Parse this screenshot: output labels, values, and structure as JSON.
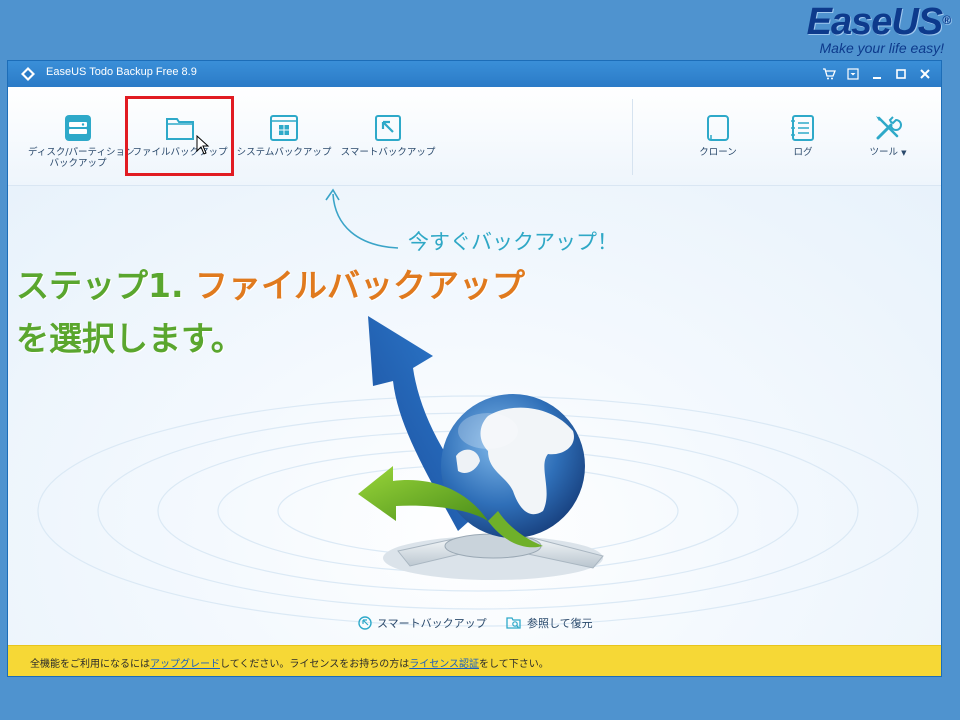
{
  "brand": {
    "name": "EaseUS",
    "reg": "®",
    "slogan": "Make your life easy!"
  },
  "window": {
    "title": "EaseUS Todo Backup Free 8.9"
  },
  "toolbar": {
    "disk_backup_line1": "ディスク/パーティション",
    "disk_backup_line2": "バックアップ",
    "file_backup": "ファイルバックアップ",
    "system_backup": "システムバックアップ",
    "smart_backup": "スマートバックアップ",
    "clone": "クローン",
    "log": "ログ",
    "tools": "ツール"
  },
  "content": {
    "cta": "今すぐバックアップ！",
    "step_prefix": "ステップ1.",
    "step_highlight": "ファイルバックアップ",
    "step_suffix": "を選択します。"
  },
  "footer": {
    "smart_backup": "スマートバックアップ",
    "browse_restore": "参照して復元"
  },
  "notice": {
    "part1": "全機能をご利用になるには",
    "upgrade_link": "アップグレード",
    "part2": "してください。ライセンスをお持ちの方は",
    "license_link": "ライセンス認証",
    "part3": "をして下さい。"
  },
  "colors": {
    "accent_blue": "#2b7bc7",
    "highlight_red": "#e11b22",
    "step_green": "#5aa62e",
    "step_orange": "#e07a1e",
    "notice_yellow": "#f6d836"
  }
}
